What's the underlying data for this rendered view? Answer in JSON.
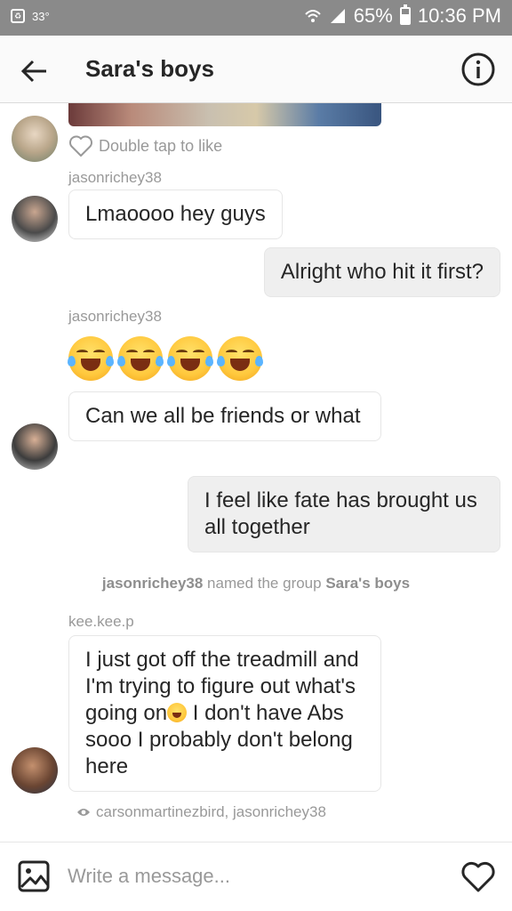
{
  "status_bar": {
    "temperature": "33°",
    "battery": "65%",
    "time": "10:36 PM"
  },
  "header": {
    "title": "Sara's boys"
  },
  "chat": {
    "like_label": "Double tap to like",
    "messages": [
      {
        "sender": "jasonrichey38",
        "text": "Lmaoooo hey guys"
      },
      {
        "sender": "me",
        "text": "Alright who hit it first?"
      },
      {
        "sender": "jasonrichey38",
        "emoji": "😂😂😂😂"
      },
      {
        "sender": "jasonrichey38",
        "text": "Can we all be friends or what"
      },
      {
        "sender": "me",
        "text": "I feel like fate has brought us all together"
      },
      {
        "sender": "kee.kee.p",
        "text_before": "I just got off the treadmill and I'm trying to figure out what's going on",
        "text_after": " I don't have Abs sooo I probably don't belong here"
      }
    ],
    "system_message": {
      "actor": "jasonrichey38",
      "action": " named the group ",
      "group_name": "Sara's boys"
    },
    "seen_by": "carsonmartinezbird, jasonrichey38"
  },
  "composer": {
    "placeholder": "Write a message..."
  }
}
